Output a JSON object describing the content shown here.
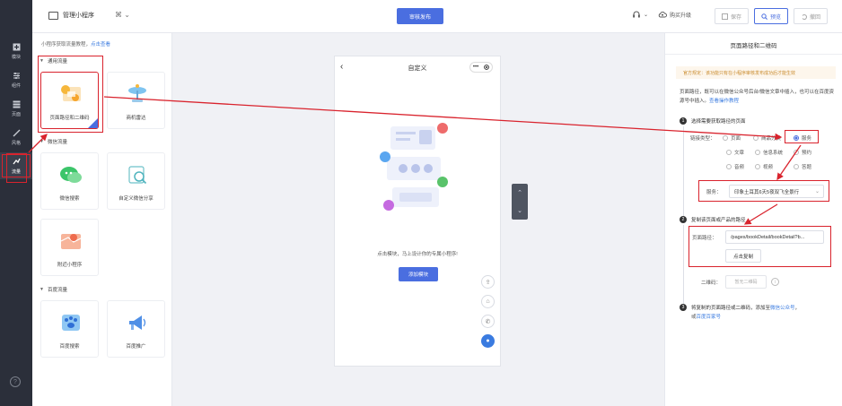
{
  "rail": {
    "items": [
      {
        "label": "模块",
        "icon": "plus-square-icon"
      },
      {
        "label": "组件",
        "icon": "sliders-icon"
      },
      {
        "label": "页面",
        "icon": "pages-icon"
      },
      {
        "label": "风格",
        "icon": "brush-icon"
      },
      {
        "label": "流量",
        "icon": "traffic-icon",
        "active": true
      }
    ],
    "help": "?"
  },
  "topbar": {
    "brand": "管理小程序",
    "grid": "⌘ ⌄",
    "publish": "审核发布",
    "support": "⌄",
    "upgrade": "购买升级",
    "save": "保存",
    "preview": "预览",
    "undo": "撤回"
  },
  "panel": {
    "hint": "小程序获取流量教程，",
    "hint_link": "点击查看",
    "groups": [
      {
        "title": "通用流量",
        "items": [
          "页面路径和二维码",
          "商机雷达"
        ]
      },
      {
        "title": "微信流量",
        "items": [
          "微信搜索",
          "自定义微信分享",
          "附近小程序"
        ]
      },
      {
        "title": "百度流量",
        "items": [
          "百度搜索",
          "百度推广"
        ]
      }
    ]
  },
  "phone": {
    "back": "‹",
    "title": "自定义",
    "caps": "•••",
    "empty_text": "点击模块，马上设计你的专属小程序!",
    "add_button": "添加模块"
  },
  "settings": {
    "title": "页面路径和二维码",
    "notice": "官方规定：该功能只有在小程序审核发布成功后才能生效",
    "desc": "页面路径，既可以在微信公众号后台/微信文章中插入，也可以在百度资源号中插入。",
    "desc_link": "查看操作教程",
    "step1": "选择需要获取路径的页面",
    "link_type_label": "链接类型：",
    "link_types": [
      "页面",
      "商品分类",
      "服务",
      "文章",
      "信息系统",
      "预约",
      "音频",
      "视频",
      "答题"
    ],
    "service_label": "服务：",
    "service_value": "印象土耳其6天5夜双飞全景行",
    "step2": "复制该页面或产品的路径",
    "path_label": "页面路径：",
    "path_value": "/pages/bookDetail/bookDetail?b...",
    "copy_button": "点击复制",
    "qr_label": "二维码：",
    "qr_button": "暂无二维码",
    "qr_info": "i",
    "step3": "将复制的页面路径或二维码，添加至",
    "step3_link1": "微信公众号",
    "step3_mid": "，",
    "step3_or": "或",
    "step3_link2": "百度百家号"
  },
  "colors": {
    "accent": "#4a6ee0",
    "highlight": "#d9232d",
    "rail": "#2b2f3a"
  }
}
